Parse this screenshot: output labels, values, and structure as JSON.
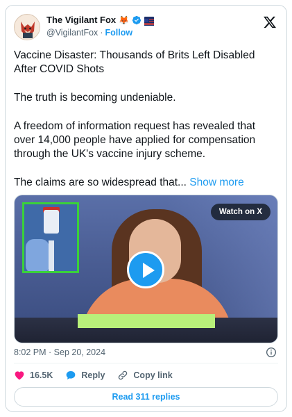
{
  "author": {
    "display_name": "The Vigilant Fox",
    "handle": "@VigilantFox",
    "separator": "·",
    "follow_label": "Follow"
  },
  "post": {
    "headline": "Vaccine Disaster: Thousands of Brits Left Disabled After COVID Shots",
    "paragraph1": "The truth is becoming undeniable.",
    "paragraph2": "A freedom of information request has revealed that over 14,000 people have applied for compensation through the UK's vaccine injury scheme.",
    "paragraph3": "The claims are so widespread that...",
    "show_more_label": "Show more"
  },
  "media": {
    "watch_label": "Watch on X",
    "play_icon": "play-icon"
  },
  "meta": {
    "timestamp": "8:02 PM · Sep 20, 2024"
  },
  "actions": {
    "likes": "16.5K",
    "reply_label": "Reply",
    "copy_link_label": "Copy link"
  },
  "footer": {
    "read_replies_label": "Read 311 replies"
  },
  "colors": {
    "accent": "#1d9bf0",
    "like": "#f91880",
    "highlight_box": "#3ad13a",
    "lower_bar": "#b8f07a"
  }
}
